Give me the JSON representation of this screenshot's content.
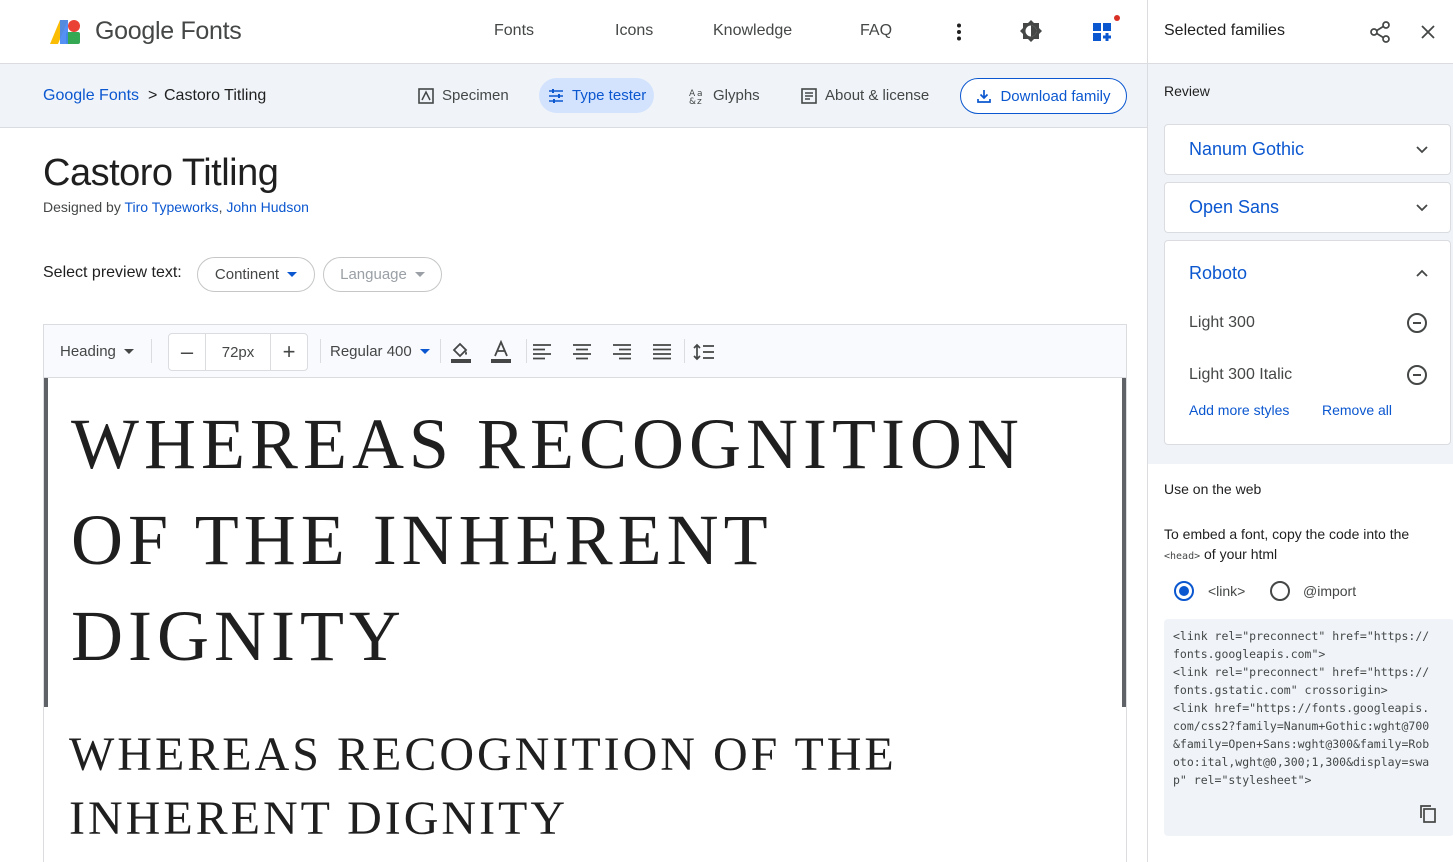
{
  "header": {
    "brand": "Google Fonts",
    "nav": [
      "Fonts",
      "Icons",
      "Knowledge",
      "FAQ"
    ],
    "more_icon": "more-vert-icon",
    "theme_icon": "brightness-icon",
    "apps_icon": "selected-families-icon",
    "accent": "#0b57d0"
  },
  "subbar": {
    "breadcrumb_root": "Google Fonts",
    "breadcrumb_sep": ">",
    "breadcrumb_current": "Castoro Titling",
    "tabs": [
      "Specimen",
      "Type tester",
      "Glyphs",
      "About & license"
    ],
    "active_tab": "Type tester",
    "download_label": "Download family"
  },
  "font": {
    "title": "Castoro Titling",
    "designed_by": "Designed by",
    "designer_1": "Tiro Typeworks",
    "designer_sep": ",",
    "designer_2": "John Hudson"
  },
  "preview": {
    "label": "Select preview text:",
    "text_choice": "Continent",
    "language_placeholder": "Language"
  },
  "tester": {
    "style_select": "Heading",
    "size_value": "72px",
    "minus": "–",
    "plus": "+",
    "weight_select": "Regular 400",
    "sample_large": "WHEREAS RECOGNITION OF THE INHERENT DIGNITY",
    "sample_medium": "WHEREAS RECOGNITION OF THE INHERENT DIGNITY"
  },
  "panel": {
    "title": "Selected families",
    "review_label": "Review",
    "families": [
      {
        "name": "Nanum Gothic",
        "expanded": false
      },
      {
        "name": "Open Sans",
        "expanded": false
      },
      {
        "name": "Roboto",
        "expanded": true,
        "styles": [
          "Light 300",
          "Light 300 Italic"
        ]
      }
    ],
    "add_styles": "Add more styles",
    "remove_all": "Remove all",
    "web_label": "Use on the web",
    "embed_text_1": "To embed a font, copy the code into the",
    "embed_code_tag": "<head>",
    "embed_text_2": "of your html",
    "radio_link": "<link>",
    "radio_import": "@import",
    "selected_radio": "<link>",
    "code_lines": [
      "<link rel=\"preconnect\" href=\"https://",
      "fonts.googleapis.com\">",
      "<link rel=\"preconnect\" href=\"https://",
      "fonts.gstatic.com\" crossorigin>",
      "<link href=\"https://fonts.googleapis.",
      "com/css2?family=Nanum+Gothic:wght@700",
      "&family=Open+Sans:wght@300&family=Rob",
      "oto:ital,wght@0,300;1,300&display=swa",
      "p\" rel=\"stylesheet\">"
    ]
  }
}
